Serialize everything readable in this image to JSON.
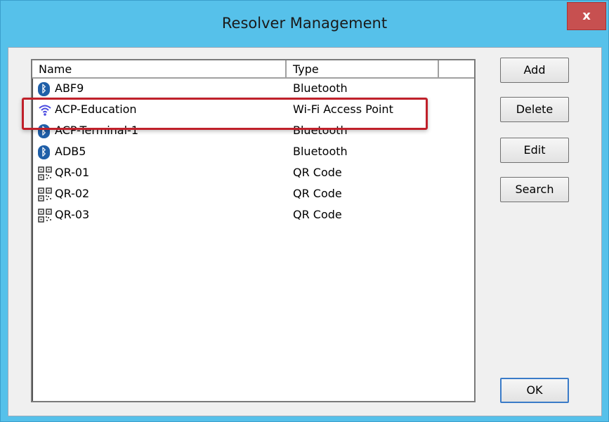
{
  "window": {
    "title": "Resolver Management",
    "close_label": "x",
    "colors": {
      "titlebar": "#56c1ea",
      "highlight": "#c0202a"
    }
  },
  "listview": {
    "columns": [
      {
        "label": "Name"
      },
      {
        "label": "Type"
      },
      {
        "label": ""
      }
    ],
    "rows": [
      {
        "icon": "bluetooth-icon",
        "name": "ABF9",
        "type": "Bluetooth"
      },
      {
        "icon": "wifi-icon",
        "name": "ACP-Education",
        "type": "Wi-Fi Access Point",
        "highlighted": true
      },
      {
        "icon": "bluetooth-icon",
        "name": "ACP-Terminal-1",
        "type": "Bluetooth"
      },
      {
        "icon": "bluetooth-icon",
        "name": "ADB5",
        "type": "Bluetooth"
      },
      {
        "icon": "qr-code-icon",
        "name": "QR-01",
        "type": "QR Code"
      },
      {
        "icon": "qr-code-icon",
        "name": "QR-02",
        "type": "QR Code"
      },
      {
        "icon": "qr-code-icon",
        "name": "QR-03",
        "type": "QR Code"
      }
    ]
  },
  "buttons": {
    "add": "Add",
    "delete": "Delete",
    "edit": "Edit",
    "search": "Search",
    "ok": "OK"
  }
}
